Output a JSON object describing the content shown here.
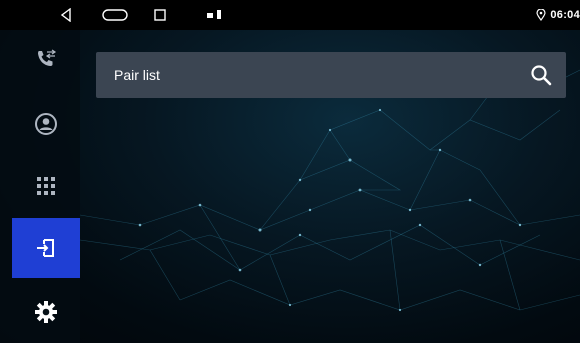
{
  "statusbar": {
    "time": "06:04",
    "icons": [
      "back-icon",
      "home-icon",
      "recents-icon",
      "notification-icon",
      "location-icon"
    ]
  },
  "sidebar": {
    "items": [
      {
        "icon": "call-log-icon",
        "active": false
      },
      {
        "icon": "contacts-icon",
        "active": false
      },
      {
        "icon": "dialpad-icon",
        "active": false
      },
      {
        "icon": "pair-list-icon",
        "active": true
      },
      {
        "icon": "settings-icon",
        "active": false
      }
    ],
    "active_color": "#1f3fd4"
  },
  "search": {
    "label": "Pair list",
    "icon": "search-icon"
  }
}
